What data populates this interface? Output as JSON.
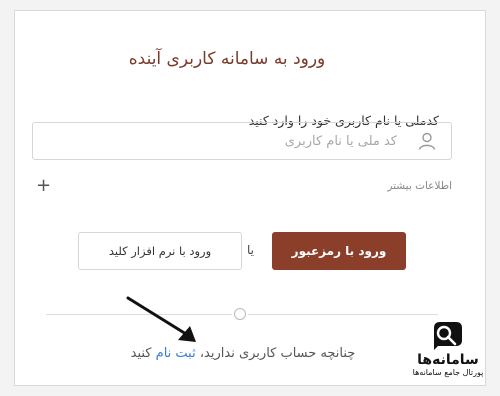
{
  "login": {
    "title": "ورود به سامانه کاربری آینده",
    "field_label": "کدملی یا نام کاربری خود را وارد کنید",
    "input_placeholder": "کد ملی یا نام کاربری",
    "input_value": "",
    "more_info_label": "اطلاعات بیشتر",
    "more_info_icon": "plus-icon",
    "password_login_label": "ورود با رمزعبور",
    "or_label": "یا",
    "software_key_login_label": "ورود با نرم افزار کلید",
    "register_prefix": "چنانچه حساب کاربری ندارید، ",
    "register_link": "ثبت نام",
    "register_suffix": " کنید"
  },
  "watermark": {
    "name": "سامانه‌ها",
    "tagline": "پورتال جامع سامانه‌ها"
  },
  "colors": {
    "accent": "#8b3f2a",
    "title": "#7a3b2c",
    "link": "#3a7bd5"
  }
}
